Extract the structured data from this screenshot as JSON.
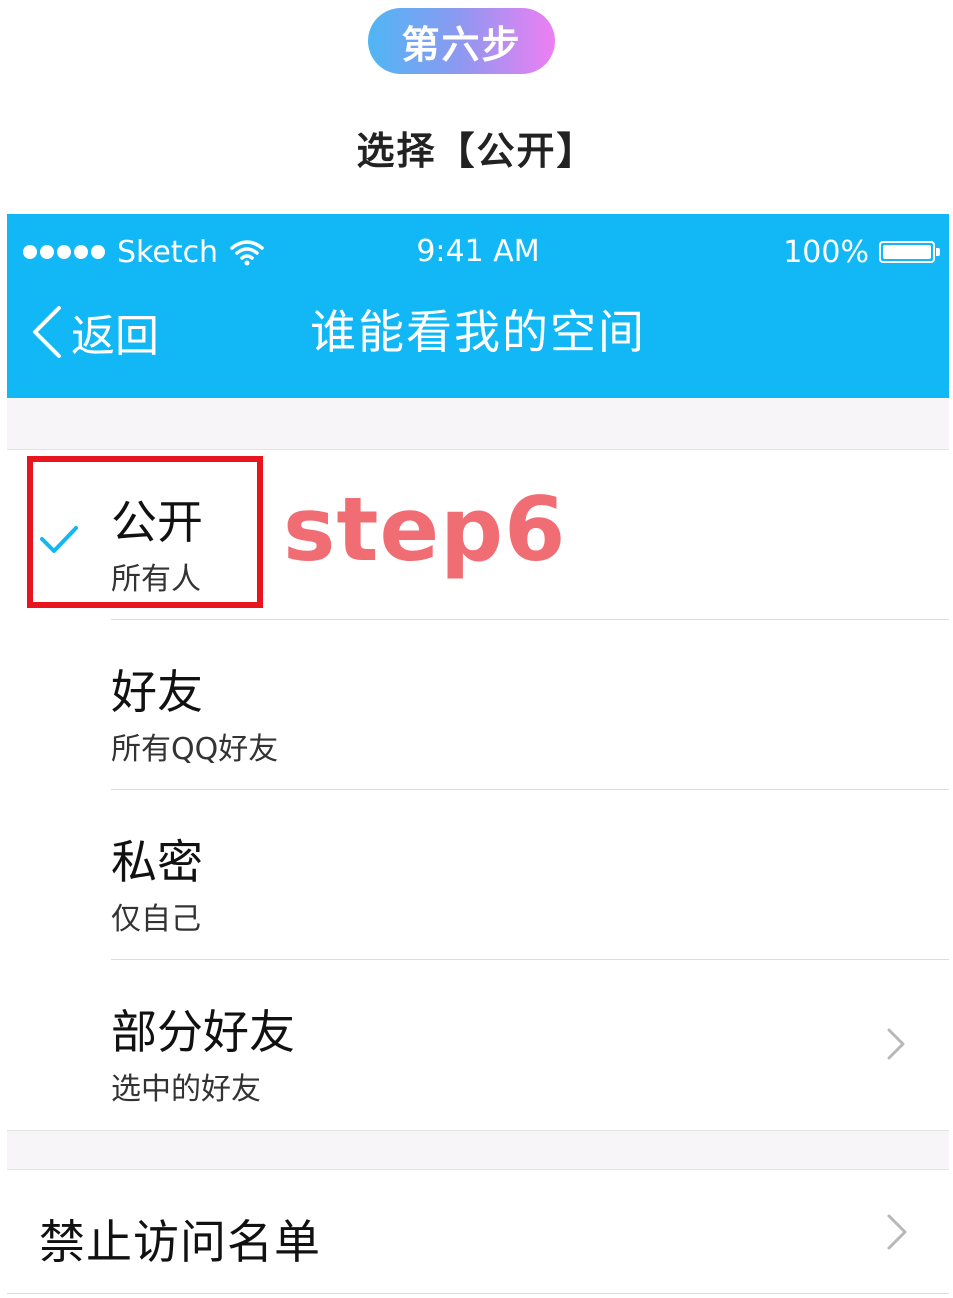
{
  "header": {
    "step_badge": "第六步",
    "instruction": "选择【公开】"
  },
  "status_bar": {
    "carrier": "Sketch",
    "time": "9:41 AM",
    "battery": "100%"
  },
  "nav": {
    "back_label": "返回",
    "title": "谁能看我的空间"
  },
  "options": [
    {
      "title": "公开",
      "subtitle": "所有人",
      "selected": true
    },
    {
      "title": "好友",
      "subtitle": "所有QQ好友",
      "selected": false
    },
    {
      "title": "私密",
      "subtitle": "仅自己",
      "selected": false
    },
    {
      "title": "部分好友",
      "subtitle": "选中的好友",
      "selected": false,
      "has_chevron": true
    }
  ],
  "annotation": {
    "step_label": "step6"
  },
  "blocklist": {
    "label": "禁止访问名单"
  },
  "colors": {
    "nav_bg": "#12b7f5",
    "check": "#12b7f5",
    "highlight_border": "#e8141e"
  }
}
